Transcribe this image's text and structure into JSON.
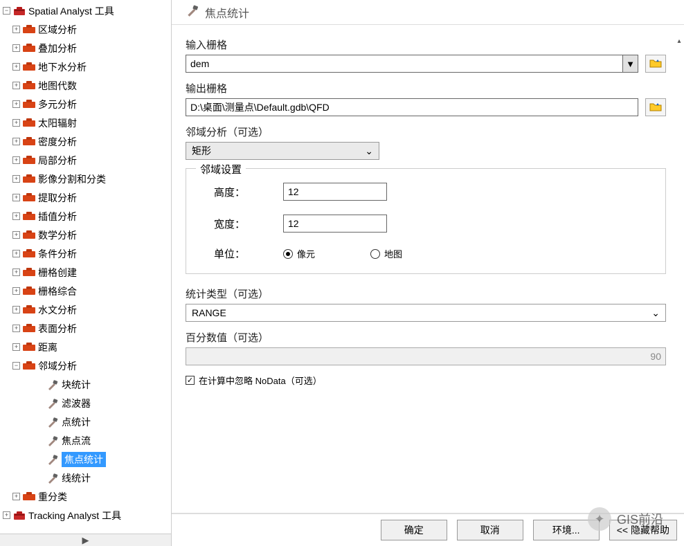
{
  "sidebar": {
    "top_toolset_label": "Spatial Analyst 工具",
    "bottom_toolset_label": "Tracking Analyst 工具",
    "items": [
      {
        "label": "区域分析"
      },
      {
        "label": "叠加分析"
      },
      {
        "label": "地下水分析"
      },
      {
        "label": "地图代数"
      },
      {
        "label": "多元分析"
      },
      {
        "label": "太阳辐射"
      },
      {
        "label": "密度分析"
      },
      {
        "label": "局部分析"
      },
      {
        "label": "影像分割和分类"
      },
      {
        "label": "提取分析"
      },
      {
        "label": "插值分析"
      },
      {
        "label": "数学分析"
      },
      {
        "label": "条件分析"
      },
      {
        "label": "栅格创建"
      },
      {
        "label": "栅格综合"
      },
      {
        "label": "水文分析"
      },
      {
        "label": "表面分析"
      },
      {
        "label": "距离"
      },
      {
        "label": "邻域分析",
        "expanded": true
      }
    ],
    "tools": [
      {
        "label": "块统计"
      },
      {
        "label": "滤波器"
      },
      {
        "label": "点统计"
      },
      {
        "label": "焦点流"
      },
      {
        "label": "焦点统计",
        "selected": true
      },
      {
        "label": "线统计"
      }
    ],
    "after_tools": [
      {
        "label": "重分类"
      }
    ]
  },
  "dialog": {
    "title": "焦点统计",
    "input_raster_label": "输入栅格",
    "input_raster_value": "dem",
    "output_raster_label": "输出栅格",
    "output_raster_value": "D:\\桌面\\测量点\\Default.gdb\\QFD",
    "neighborhood_label": "邻域分析（可选）",
    "neighborhood_value": "矩形",
    "settings_title": "邻域设置",
    "height_label": "高度：",
    "height_value": "12",
    "width_label": "宽度：",
    "width_value": "12",
    "units_label": "单位：",
    "units_cell": "像元",
    "units_map": "地图",
    "stat_type_label": "统计类型（可选）",
    "stat_type_value": "RANGE",
    "percentile_label": "百分数值（可选）",
    "percentile_value": "90",
    "ignore_nodata_label": "在计算中忽略 NoData（可选）"
  },
  "buttons": {
    "ok": "确定",
    "cancel": "取消",
    "env": "环境...",
    "help": "<< 隐藏帮助"
  },
  "watermark": {
    "text": "GIS前沿"
  }
}
